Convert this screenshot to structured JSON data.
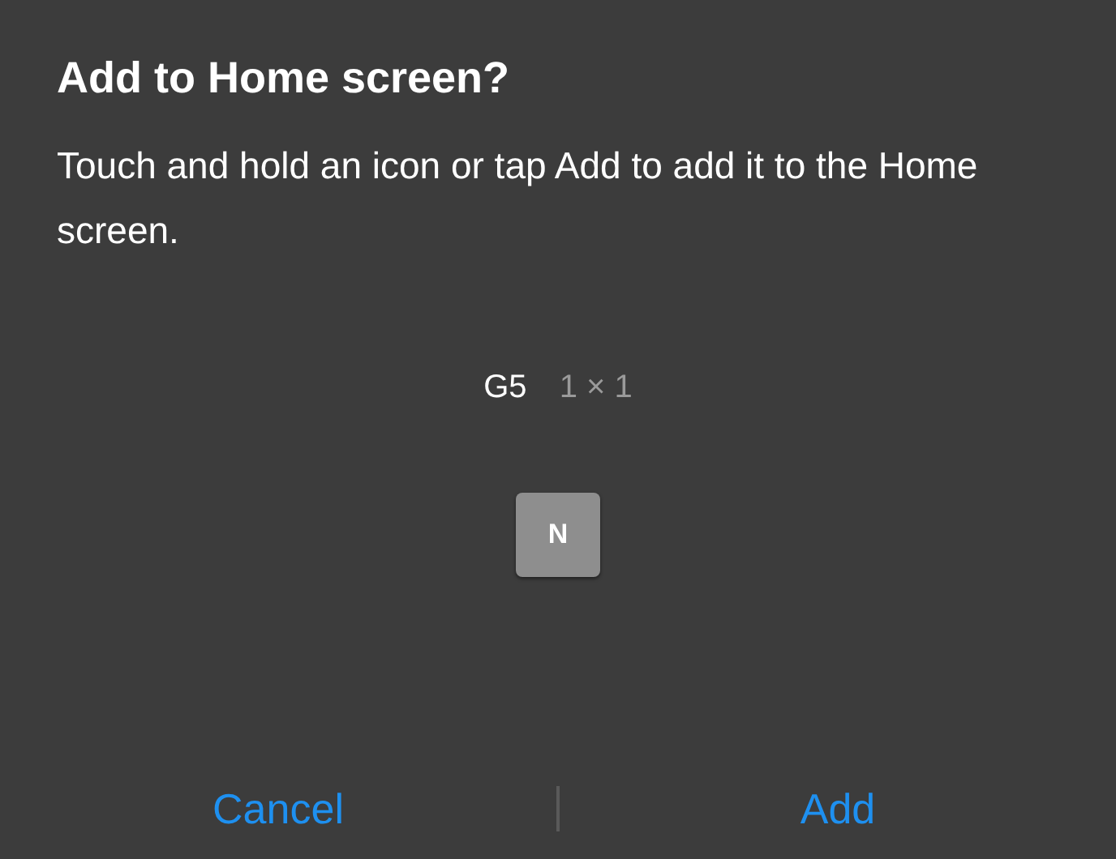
{
  "dialog": {
    "title": "Add to Home screen?",
    "message": "Touch and hold an icon or tap Add to add it to the Home screen.",
    "widget": {
      "name": "G5",
      "size": "1 × 1",
      "icon_letter": "N"
    },
    "buttons": [
      {
        "label": "Cancel"
      },
      {
        "label": "Add"
      }
    ]
  }
}
